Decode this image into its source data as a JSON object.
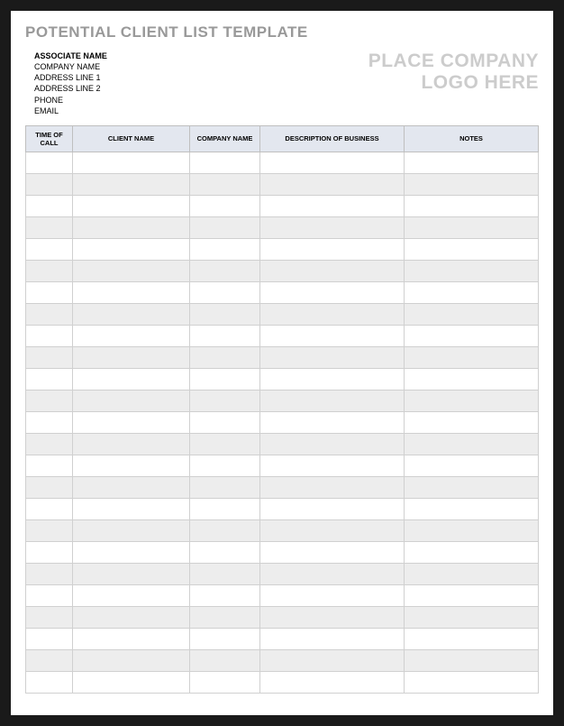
{
  "title": "POTENTIAL CLIENT LIST TEMPLATE",
  "associate": {
    "name_label": "ASSOCIATE NAME",
    "fields": [
      "COMPANY NAME",
      "ADDRESS LINE 1",
      "ADDRESS LINE 2",
      "PHONE",
      "EMAIL"
    ]
  },
  "logo_placeholder": {
    "line1": "PLACE COMPANY",
    "line2": "LOGO HERE"
  },
  "table": {
    "headers": {
      "time_of_call": "TIME OF CALL",
      "client_name": "CLIENT NAME",
      "company_name": "COMPANY NAME",
      "description": "DESCRIPTION OF BUSINESS",
      "notes": "NOTES"
    },
    "rows": [
      {
        "time": "",
        "client": "",
        "company": "",
        "desc": "",
        "notes": ""
      },
      {
        "time": "",
        "client": "",
        "company": "",
        "desc": "",
        "notes": ""
      },
      {
        "time": "",
        "client": "",
        "company": "",
        "desc": "",
        "notes": ""
      },
      {
        "time": "",
        "client": "",
        "company": "",
        "desc": "",
        "notes": ""
      },
      {
        "time": "",
        "client": "",
        "company": "",
        "desc": "",
        "notes": ""
      },
      {
        "time": "",
        "client": "",
        "company": "",
        "desc": "",
        "notes": ""
      },
      {
        "time": "",
        "client": "",
        "company": "",
        "desc": "",
        "notes": ""
      },
      {
        "time": "",
        "client": "",
        "company": "",
        "desc": "",
        "notes": ""
      },
      {
        "time": "",
        "client": "",
        "company": "",
        "desc": "",
        "notes": ""
      },
      {
        "time": "",
        "client": "",
        "company": "",
        "desc": "",
        "notes": ""
      },
      {
        "time": "",
        "client": "",
        "company": "",
        "desc": "",
        "notes": ""
      },
      {
        "time": "",
        "client": "",
        "company": "",
        "desc": "",
        "notes": ""
      },
      {
        "time": "",
        "client": "",
        "company": "",
        "desc": "",
        "notes": ""
      },
      {
        "time": "",
        "client": "",
        "company": "",
        "desc": "",
        "notes": ""
      },
      {
        "time": "",
        "client": "",
        "company": "",
        "desc": "",
        "notes": ""
      },
      {
        "time": "",
        "client": "",
        "company": "",
        "desc": "",
        "notes": ""
      },
      {
        "time": "",
        "client": "",
        "company": "",
        "desc": "",
        "notes": ""
      },
      {
        "time": "",
        "client": "",
        "company": "",
        "desc": "",
        "notes": ""
      },
      {
        "time": "",
        "client": "",
        "company": "",
        "desc": "",
        "notes": ""
      },
      {
        "time": "",
        "client": "",
        "company": "",
        "desc": "",
        "notes": ""
      },
      {
        "time": "",
        "client": "",
        "company": "",
        "desc": "",
        "notes": ""
      },
      {
        "time": "",
        "client": "",
        "company": "",
        "desc": "",
        "notes": ""
      },
      {
        "time": "",
        "client": "",
        "company": "",
        "desc": "",
        "notes": ""
      },
      {
        "time": "",
        "client": "",
        "company": "",
        "desc": "",
        "notes": ""
      },
      {
        "time": "",
        "client": "",
        "company": "",
        "desc": "",
        "notes": ""
      }
    ]
  }
}
